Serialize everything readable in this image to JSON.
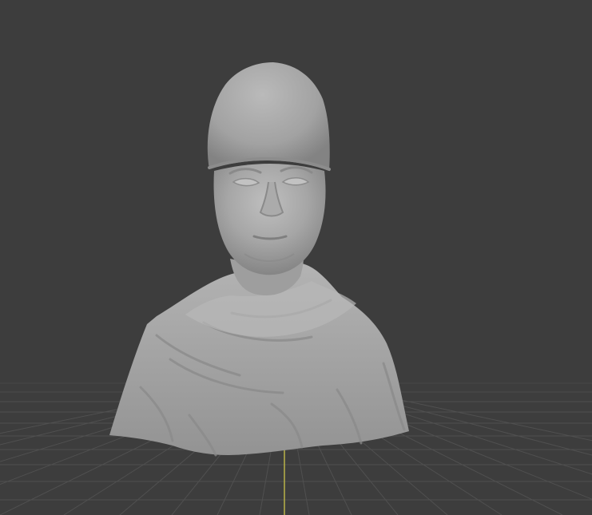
{
  "viewport": {
    "background_color": "#3d3d3d",
    "grid_color": "#505050",
    "y_axis_color": "#b9b348",
    "object": {
      "type": "sculpted bust",
      "material_color": "#a3a3a3"
    }
  }
}
